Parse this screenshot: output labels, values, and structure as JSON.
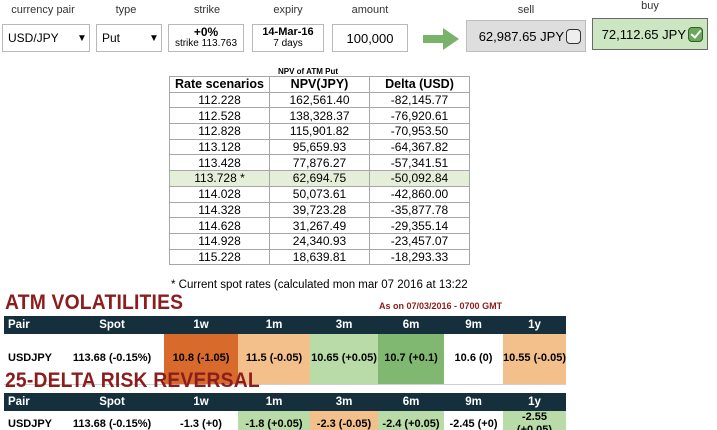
{
  "form": {
    "labels": {
      "currency_pair": "currency pair",
      "type": "type",
      "strike": "strike",
      "expiry": "expiry",
      "amount": "amount",
      "sell": "sell",
      "buy": "buy"
    },
    "currency_pair": "USD/JPY",
    "type": "Put",
    "strike_pct": "+0%",
    "strike_value": "strike 113.763",
    "expiry_date": "14-Mar-16",
    "expiry_days": "7 days",
    "amount": "100,000",
    "sell_price": "62,987.65 JPY",
    "buy_price": "72,112.65 JPY",
    "buy_selected": true,
    "sell_selected": false
  },
  "npv": {
    "title": "NPV of ATM Put",
    "headers": [
      "Rate scenarios",
      "NPV(JPY)",
      "Delta (USD)"
    ],
    "rows": [
      [
        "112.228",
        "162,561.40",
        "-82,145.77"
      ],
      [
        "112.528",
        "138,328.37",
        "-76,920.61"
      ],
      [
        "112.828",
        "115,901.82",
        "-70,953.50"
      ],
      [
        "113.128",
        "95,659.93",
        "-64,367.82"
      ],
      [
        "113.428",
        "77,876.27",
        "-57,341.51"
      ],
      [
        "113.728 *",
        "62,694.75",
        "-50,092.84"
      ],
      [
        "114.028",
        "50,073.61",
        "-42,860.00"
      ],
      [
        "114.328",
        "39,723.28",
        "-35,877.78"
      ],
      [
        "114.628",
        "31,267.49",
        "-29,355.14"
      ],
      [
        "114.928",
        "24,340.93",
        "-23,457.07"
      ],
      [
        "115.228",
        "18,639.81",
        "-18,293.33"
      ]
    ],
    "highlight_row": 5,
    "footnote": "* Current spot rates (calculated mon mar 07 2016 at 13:22"
  },
  "atm": {
    "title": "ATM VOLATILITIES",
    "as_of": "As on 07/03/2016 - 0700 GMT",
    "headers": [
      "Pair",
      "Spot",
      "1w",
      "1m",
      "3m",
      "6m",
      "9m",
      "1y"
    ],
    "row": {
      "pair": "USDJPY",
      "spot": "113.68 (-0.15%)",
      "values": [
        "10.8 (-1.05)",
        "11.5 (-0.05)",
        "10.65 (+0.05)",
        "10.7 (+0.1)",
        "10.6 (0)",
        "10.55 (-0.05)"
      ],
      "colors": [
        "#d86a2c",
        "#f3c08c",
        "#b9dba8",
        "#80b872",
        "#ffffff",
        "#f3c08c"
      ]
    }
  },
  "rr": {
    "title": "25-DELTA RISK REVERSAL",
    "headers": [
      "Pair",
      "Spot",
      "1w",
      "1m",
      "3m",
      "6m",
      "9m",
      "1y"
    ],
    "row": {
      "pair": "USDJPY",
      "spot": "113.68 (-0.15%)",
      "values": [
        "-1.3 (+0)",
        "-1.8 (+0.05)",
        "-2.3 (-0.05)",
        "-2.4 (+0.05)",
        "-2.45 (+0)",
        "-2.55 (+0.05)"
      ],
      "colors": [
        "#ffffff",
        "#b9dba8",
        "#f3c08c",
        "#b9dba8",
        "#ffffff",
        "#b9dba8"
      ]
    }
  }
}
